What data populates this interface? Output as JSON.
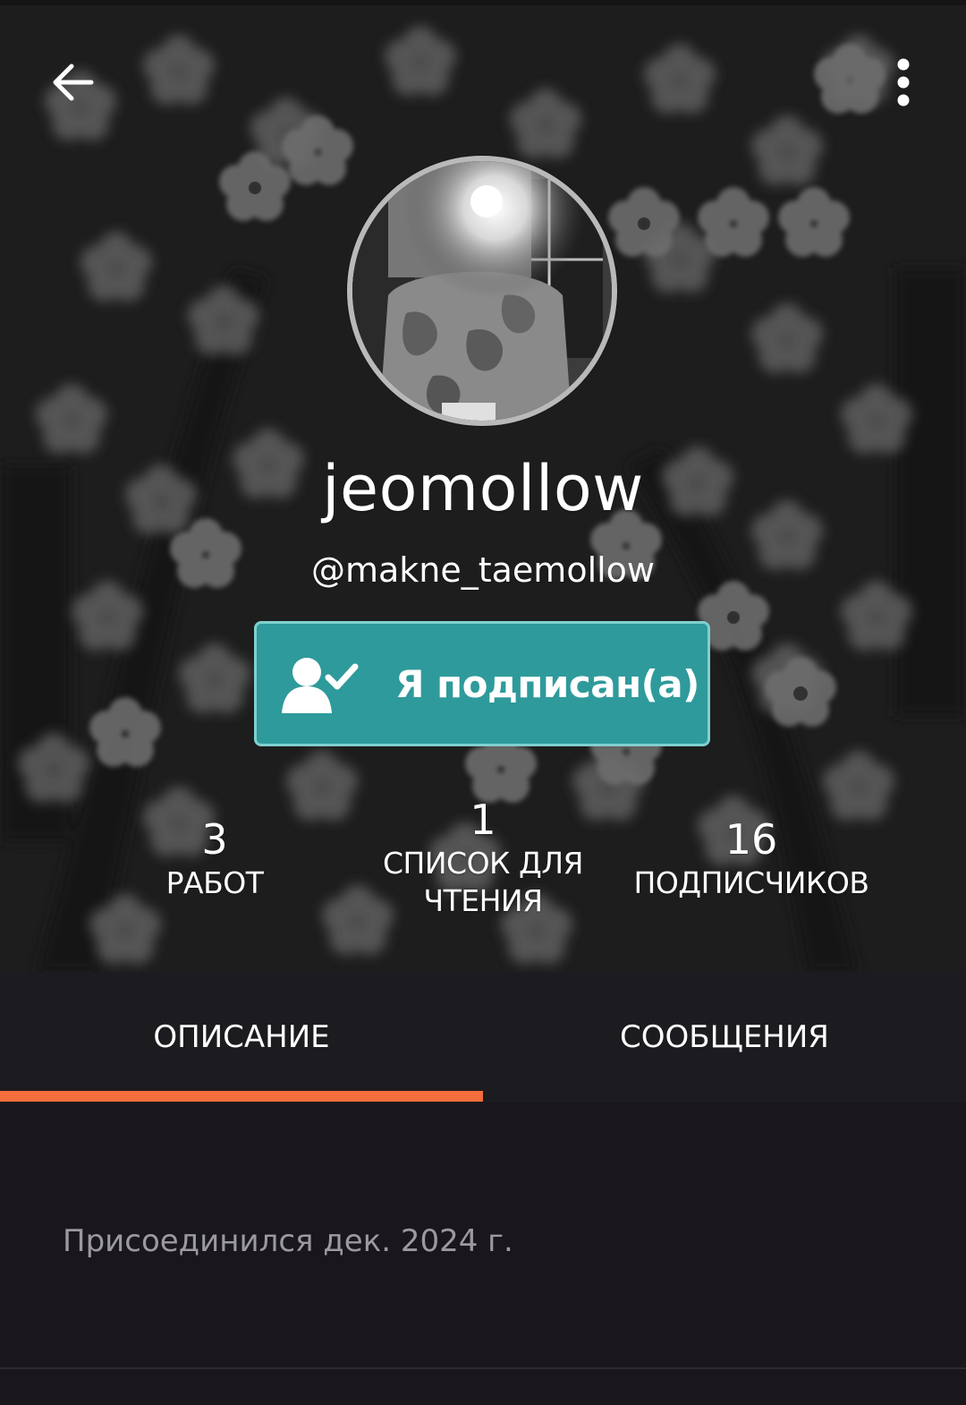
{
  "toolbar": {
    "back_icon": "arrow-left-icon",
    "menu_icon": "more-vertical-icon"
  },
  "profile": {
    "display_name": "jeomollow",
    "username": "@makne_taemollow",
    "avatar": "profile-photo"
  },
  "follow_button": {
    "label": "Я подписан(а)",
    "icon": "user-check-icon",
    "color": "#2f9a9b"
  },
  "stats": {
    "works": {
      "count": "3",
      "label": "РАБОТ"
    },
    "reading_lists": {
      "count": "1",
      "label_line1": "СПИСОК ДЛЯ",
      "label_line2": "ЧТЕНИЯ"
    },
    "followers": {
      "count": "16",
      "label": "ПОДПИСЧИКОВ"
    }
  },
  "tabs": [
    {
      "label": "ОПИСАНИЕ",
      "active": true
    },
    {
      "label": "СООБЩЕНИЯ",
      "active": false
    }
  ],
  "tab_indicator_color": "#f46d3c",
  "about": {
    "joined": "Присоединился дек. 2024 г."
  }
}
